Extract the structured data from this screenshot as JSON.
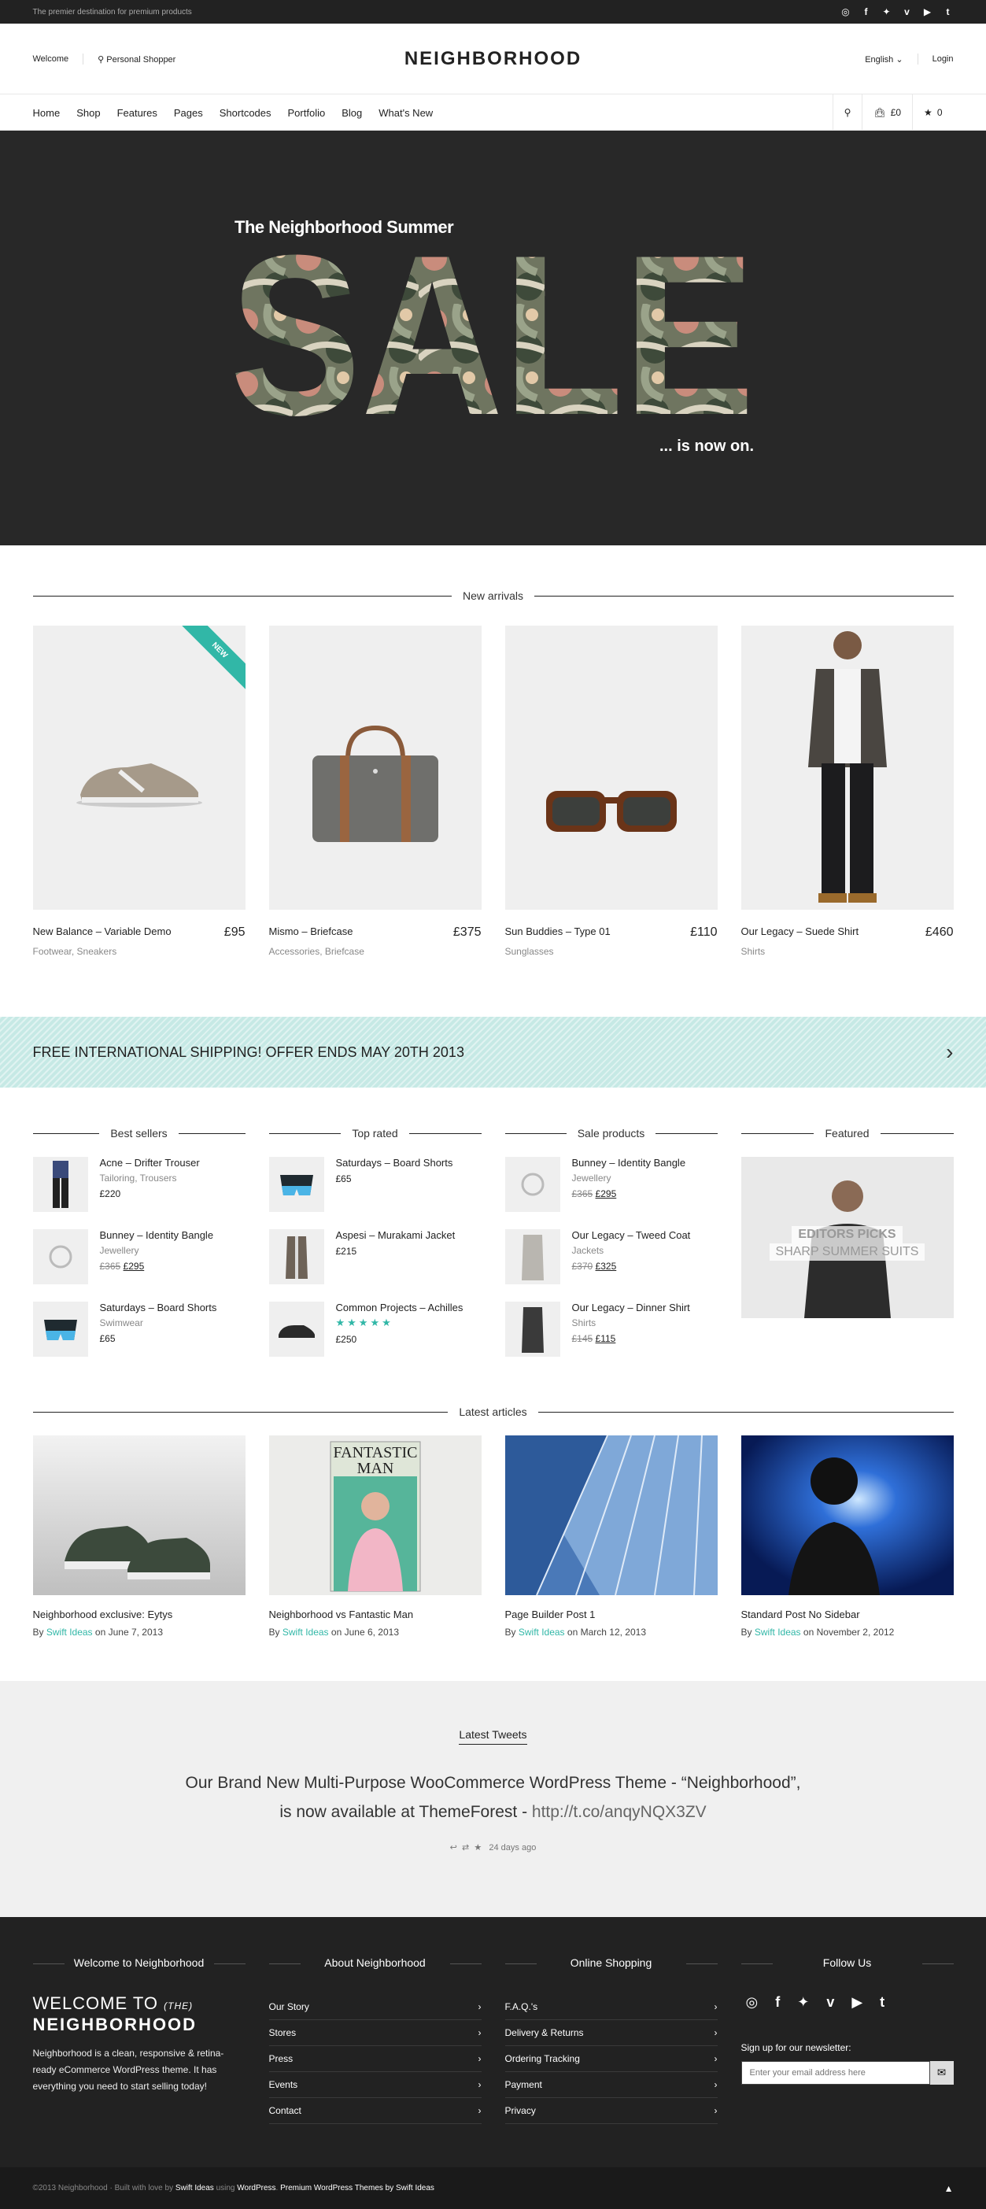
{
  "topbar": {
    "tagline": "The premier destination for premium products",
    "social": [
      "dribbble-icon",
      "facebook-icon",
      "twitter-icon",
      "vimeo-icon",
      "youtube-icon",
      "tumblr-icon"
    ]
  },
  "header": {
    "welcome": "Welcome",
    "shopper": "Personal Shopper",
    "logo": "NEIGHBORHOOD",
    "language": "English",
    "login": "Login"
  },
  "nav": {
    "items": [
      "Home",
      "Shop",
      "Features",
      "Pages",
      "Shortcodes",
      "Portfolio",
      "Blog",
      "What's New"
    ],
    "cart": "£0",
    "wishlist": "0"
  },
  "hero": {
    "subtitle": "The Neighborhood Summer",
    "big": "SALE",
    "footer": "... is now on."
  },
  "new_arrivals": {
    "heading": "New arrivals",
    "badge": "NEW",
    "items": [
      {
        "name": "New Balance – Variable Demo",
        "price": "£95",
        "cat": "Footwear, Sneakers"
      },
      {
        "name": "Mismo – Briefcase",
        "price": "£375",
        "cat": "Accessories, Briefcase"
      },
      {
        "name": "Sun Buddies – Type 01",
        "price": "£110",
        "cat": "Sunglasses"
      },
      {
        "name": "Our Legacy – Suede Shirt",
        "price": "£460",
        "cat": "Shirts"
      }
    ]
  },
  "promo": {
    "text": "FREE INTERNATIONAL SHIPPING! OFFER ENDS MAY 20TH 2013"
  },
  "widgets": {
    "best": {
      "heading": "Best sellers",
      "items": [
        {
          "name": "Acne – Drifter Trouser",
          "sub": "Tailoring, Trousers",
          "price": "£220"
        },
        {
          "name": "Bunney – Identity Bangle",
          "sub": "Jewellery",
          "old": "£365",
          "price": "£295"
        },
        {
          "name": "Saturdays – Board Shorts",
          "sub": "Swimwear",
          "price": "£65"
        }
      ]
    },
    "top": {
      "heading": "Top rated",
      "items": [
        {
          "name": "Saturdays – Board Shorts",
          "price": "£65"
        },
        {
          "name": "Aspesi – Murakami Jacket",
          "price": "£215"
        },
        {
          "name": "Common Projects – Achilles",
          "stars": "★★★★★",
          "price": "£250"
        }
      ]
    },
    "sale": {
      "heading": "Sale products",
      "items": [
        {
          "name": "Bunney – Identity Bangle",
          "sub": "Jewellery",
          "old": "£365",
          "price": "£295"
        },
        {
          "name": "Our Legacy – Tweed Coat",
          "sub": "Jackets",
          "old": "£370",
          "price": "£325"
        },
        {
          "name": "Our Legacy – Dinner Shirt",
          "sub": "Shirts",
          "old": "£145",
          "price": "£115"
        }
      ]
    },
    "featured": {
      "heading": "Featured",
      "line1": "EDITORS PICKS",
      "line2": "SHARP SUMMER SUITS"
    }
  },
  "articles": {
    "heading": "Latest articles",
    "by": "By",
    "author": "Swift Ideas",
    "on": "on",
    "items": [
      {
        "title": "Neighborhood exclusive: Eytys",
        "date": "June 7, 2013"
      },
      {
        "title": "Neighborhood vs Fantastic Man",
        "date": "June 6, 2013"
      },
      {
        "title": "Page Builder Post 1",
        "date": "March 12, 2013"
      },
      {
        "title": "Standard Post No Sidebar",
        "date": "November 2, 2012"
      }
    ],
    "magazine1": "FANTASTIC",
    "magazine2": "MAN"
  },
  "tweets": {
    "heading": "Latest Tweets",
    "line1": "Our Brand New Multi-Purpose WooCommerce WordPress Theme - “Neighborhood”,",
    "line2": "is now available at ThemeForest - ",
    "link": "http://t.co/anqyNQX3ZV",
    "ago": "24 days ago"
  },
  "footer": {
    "c1": {
      "heading": "Welcome to Neighborhood",
      "w1": "WELCOME TO",
      "w1b": "(THE)",
      "w2": "NEIGHBORHOOD",
      "text": "Neighborhood is a clean, responsive & retina-ready eCommerce WordPress theme. It has everything you need to start selling today!"
    },
    "c2": {
      "heading": "About Neighborhood",
      "links": [
        "Our Story",
        "Stores",
        "Press",
        "Events",
        "Contact"
      ]
    },
    "c3": {
      "heading": "Online Shopping",
      "links": [
        "F.A.Q.'s",
        "Delivery & Returns",
        "Ordering Tracking",
        "Payment",
        "Privacy"
      ]
    },
    "c4": {
      "heading": "Follow Us",
      "newsletter": "Sign up for our newsletter:",
      "placeholder": "Enter your email address here"
    }
  },
  "bottom": {
    "copy": "©2013 Neighborhood · Built with love by ",
    "swift": "Swift Ideas",
    "using": " using ",
    "wp": "WordPress",
    "premium": "Premium WordPress Themes by Swift Ideas"
  }
}
